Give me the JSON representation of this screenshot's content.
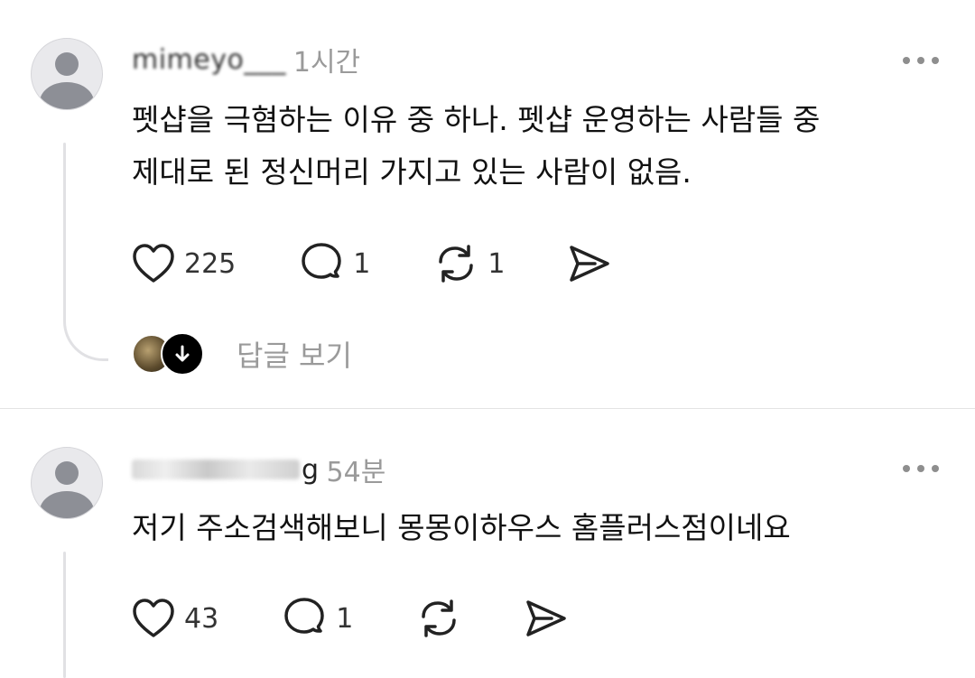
{
  "posts": [
    {
      "username_visible": "mimeyo___",
      "time": "1시간",
      "lines": [
        "펫샵을 극혐하는 이유 중 하나. 펫샵 운영하는 사람들 중",
        "제대로 된 정신머리 가지고 있는 사람이 없음."
      ],
      "likes": "225",
      "comments": "1",
      "reposts": "1",
      "view_replies": "답글 보기"
    },
    {
      "username_visible": "g",
      "time": "54분",
      "lines": [
        "저기 주소검색해보니 몽몽이하우스 홈플러스점이네요"
      ],
      "likes": "43",
      "comments": "1",
      "reposts": ""
    }
  ],
  "icons": [
    "avatar-icon",
    "more-icon",
    "heart-icon",
    "comment-icon",
    "repost-icon",
    "share-icon",
    "arrow-down-icon"
  ]
}
